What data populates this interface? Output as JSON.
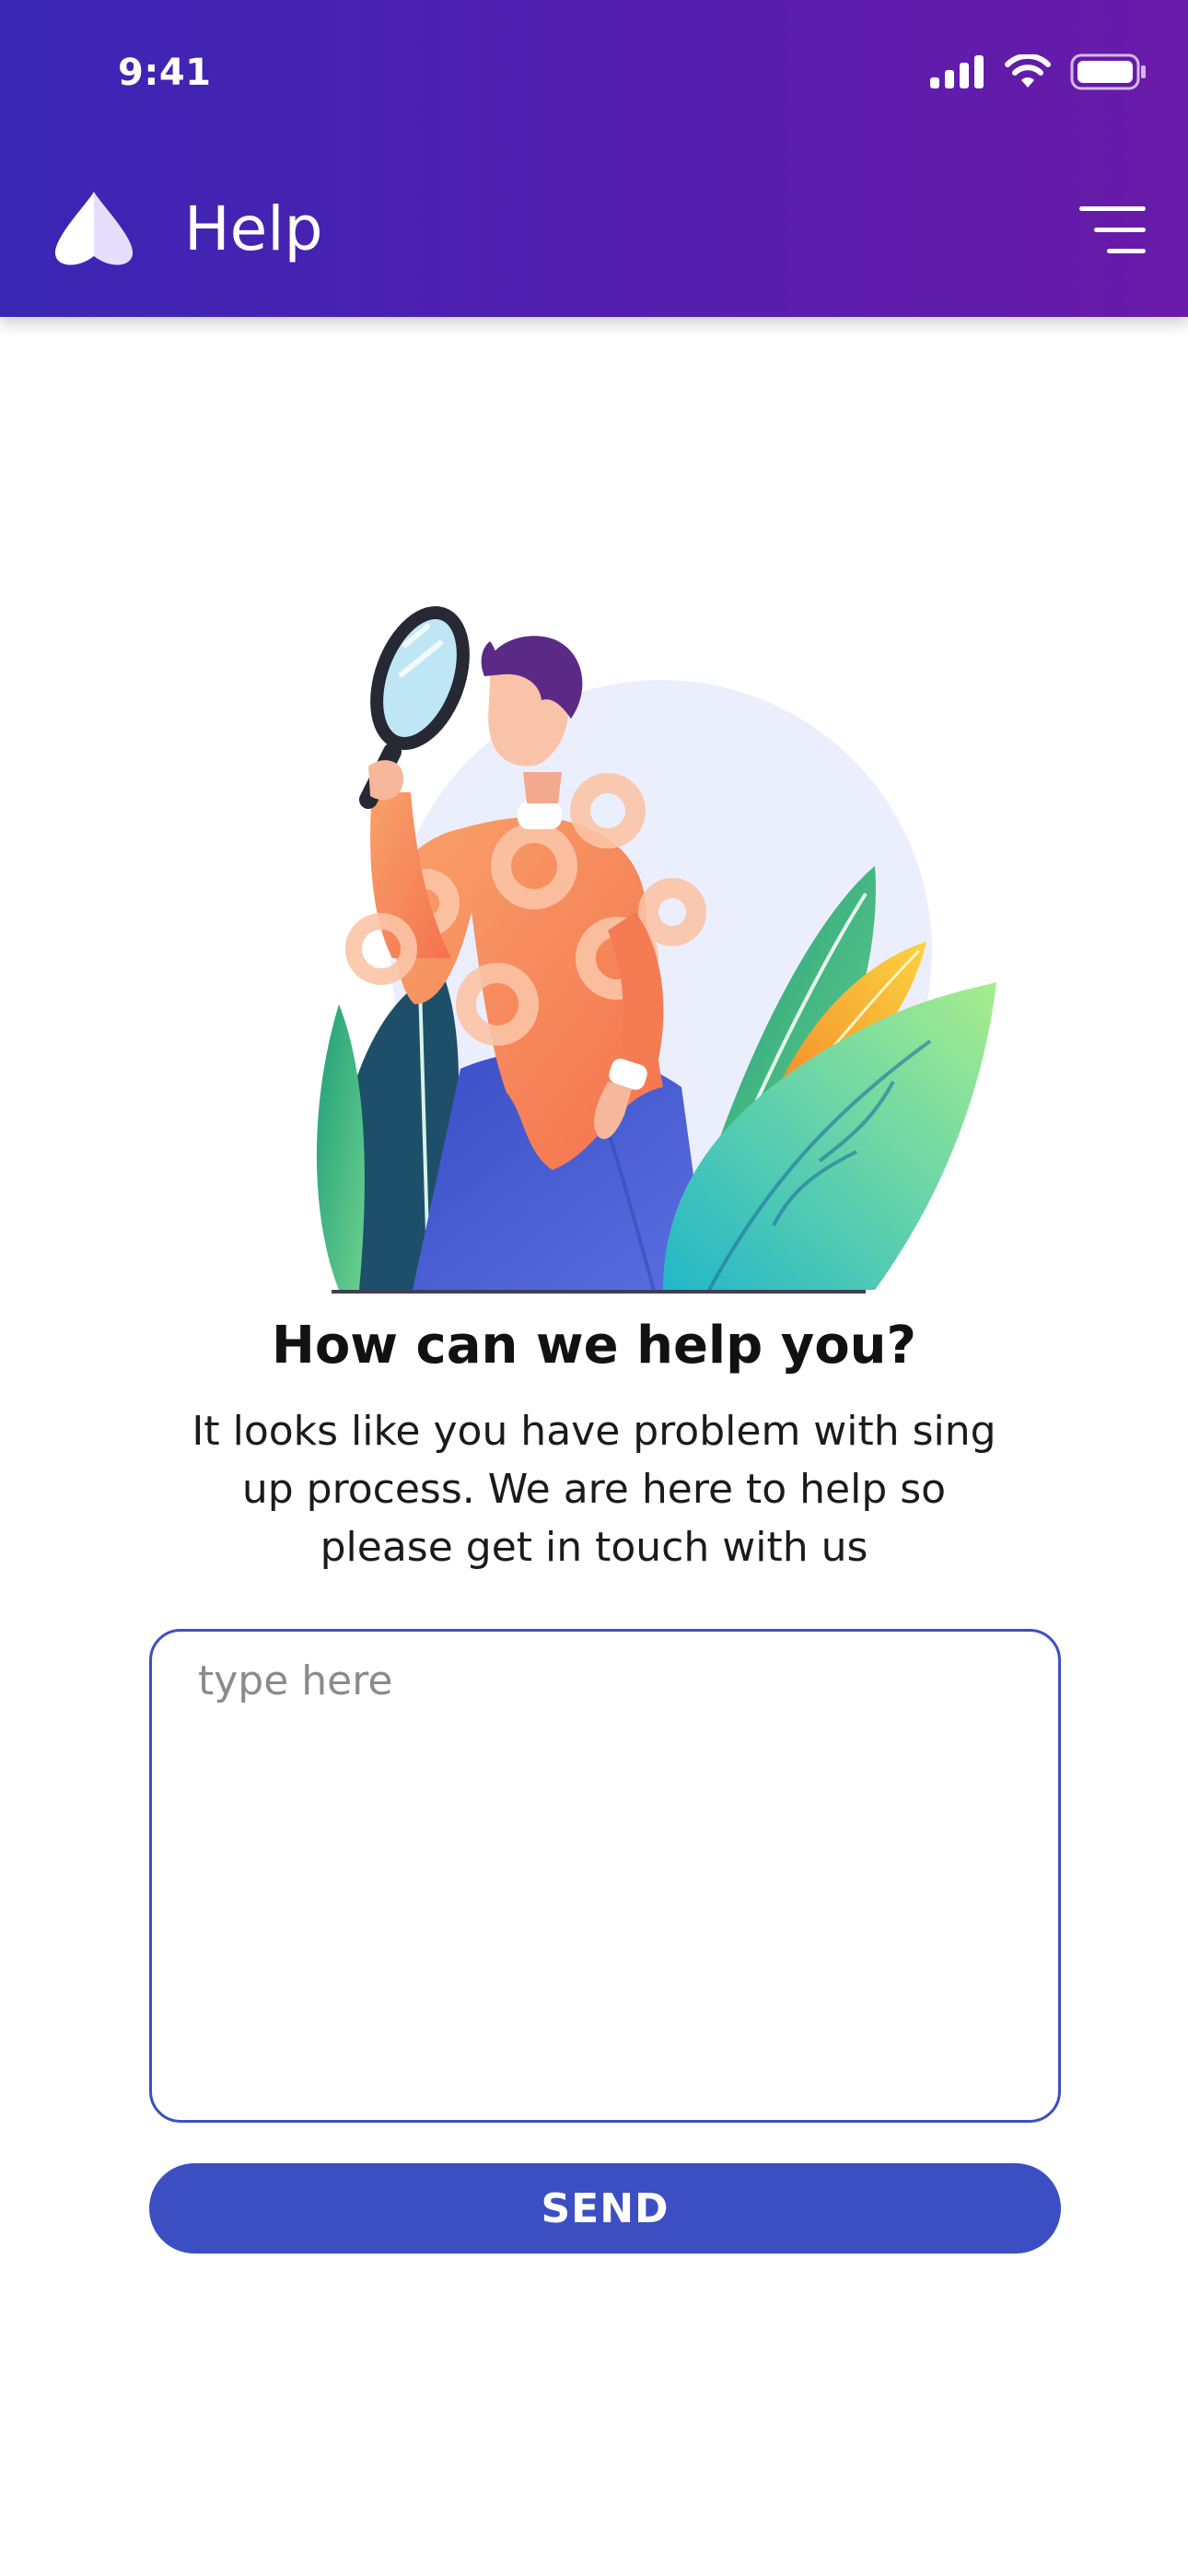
{
  "status_bar": {
    "time": "9:41",
    "icons": [
      "cellular-signal-icon",
      "wifi-icon",
      "battery-icon"
    ]
  },
  "header": {
    "logo": "app-logo-icon",
    "title": "Help",
    "menu_icon": "hamburger-menu-icon"
  },
  "illustration": {
    "description_icon": "person-with-magnifying-glass-illustration"
  },
  "main": {
    "heading": "How can we help you?",
    "description": "It looks like you have problem with sing up process. We are here to help so please get in touch with us"
  },
  "form": {
    "message_placeholder": "type here",
    "message_value": "",
    "send_label": "SEND"
  },
  "colors": {
    "header_gradient_start": "#3a26b4",
    "header_gradient_end": "#6a1aa8",
    "accent": "#3c4fc2",
    "text_primary": "#111111"
  }
}
